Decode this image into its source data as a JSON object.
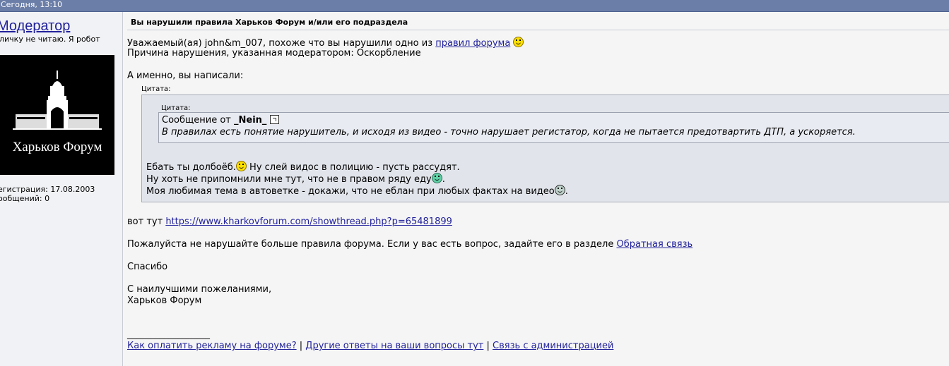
{
  "topbar": {
    "date": "Сегодня, 13:10"
  },
  "sidebar": {
    "username": "Модератор",
    "user_title": "личку не читаю. Я робот",
    "avatar_text": "Харьков Форум",
    "registration": "егистрация: 17.08.2003",
    "posts": "ообщений: 0"
  },
  "post": {
    "title": "Вы нарушили правила Харьков Форум и/или его подраздела",
    "greeting": "Уважаемый(ая) john&m_007, похоже что вы нарушили одно из",
    "rules_link": "правил форума",
    "reason": "Причина нарушения, указанная модератором: Оскорбление",
    "namely": "А именно, вы написали:",
    "quote_label": "Цитата:",
    "inner_quote_label": "Цитата:",
    "inner_quote_from": "Сообщение от",
    "inner_quote_author": "_Nein_",
    "inner_quote_text": "В правилах есть понятие нарушитель, и исходя из видео - точно нарушает регистатор, когда не пытается предотвартить ДТП, а ускоряется.",
    "quote_line1": "Ебать ты долбоёб.",
    "quote_line1b": "Ну слей видос в полицию - пусть рассудят.",
    "quote_line2": "Ну хоть не припомнили мне тут, что не в правом ряду еду",
    "quote_line3": "Моя любимая тема в автоветке - докажи, что не еблан при любых фактах на видео",
    "here_label": "вот тут",
    "here_link": "https://www.kharkovforum.com/showthread.php?p=65481899",
    "please": "Пожалуйста не нарушайте больше правила форума. Если у вас есть вопрос, задайте его в разделе",
    "feedback_link": "Обратная связь",
    "thanks": "Спасибо",
    "regards": "С наилучшими пожеланиями,",
    "signature": "Харьков Форум",
    "sig_separator": "__________________",
    "footer_link1": "Как оплатить рекламу на форуме?",
    "footer_sep": "|",
    "footer_link2": "Другие ответы на ваши вопросы тут",
    "footer_link3": "Связь с администрацией"
  }
}
